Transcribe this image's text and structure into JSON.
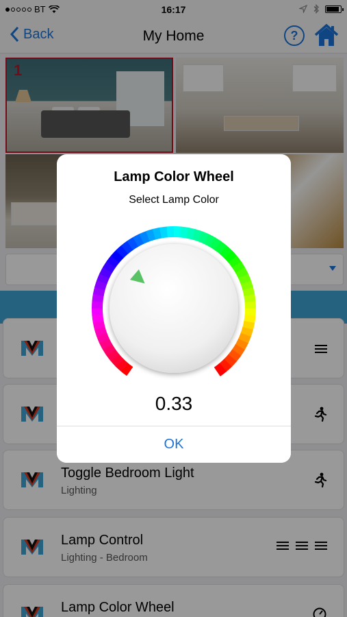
{
  "status_bar": {
    "carrier": "BT",
    "signal_bars_filled": 1,
    "signal_bars_total": 5,
    "time": "16:17",
    "battery_level": 0.9
  },
  "nav": {
    "back_label": "Back",
    "title": "My Home",
    "help_label": "?",
    "accent_color": "#1a73d9"
  },
  "rooms": {
    "selected_number": "1"
  },
  "list": {
    "items": [
      {
        "title": "",
        "subtitle": "",
        "icon": "menu-icon"
      },
      {
        "title": "",
        "subtitle": "",
        "icon": "running-person-icon"
      },
      {
        "title": "Toggle Bedroom Light",
        "subtitle": "Lighting",
        "icon": "running-person-icon"
      },
      {
        "title": "Lamp Control",
        "subtitle": "Lighting - Bedroom",
        "icon": "triple-menu-icon"
      },
      {
        "title": "Lamp Color Wheel",
        "subtitle": "",
        "icon": "gauge-icon"
      }
    ]
  },
  "modal": {
    "title": "Lamp Color Wheel",
    "subtitle": "Select Lamp Color",
    "value": "0.33",
    "ok_label": "OK"
  }
}
